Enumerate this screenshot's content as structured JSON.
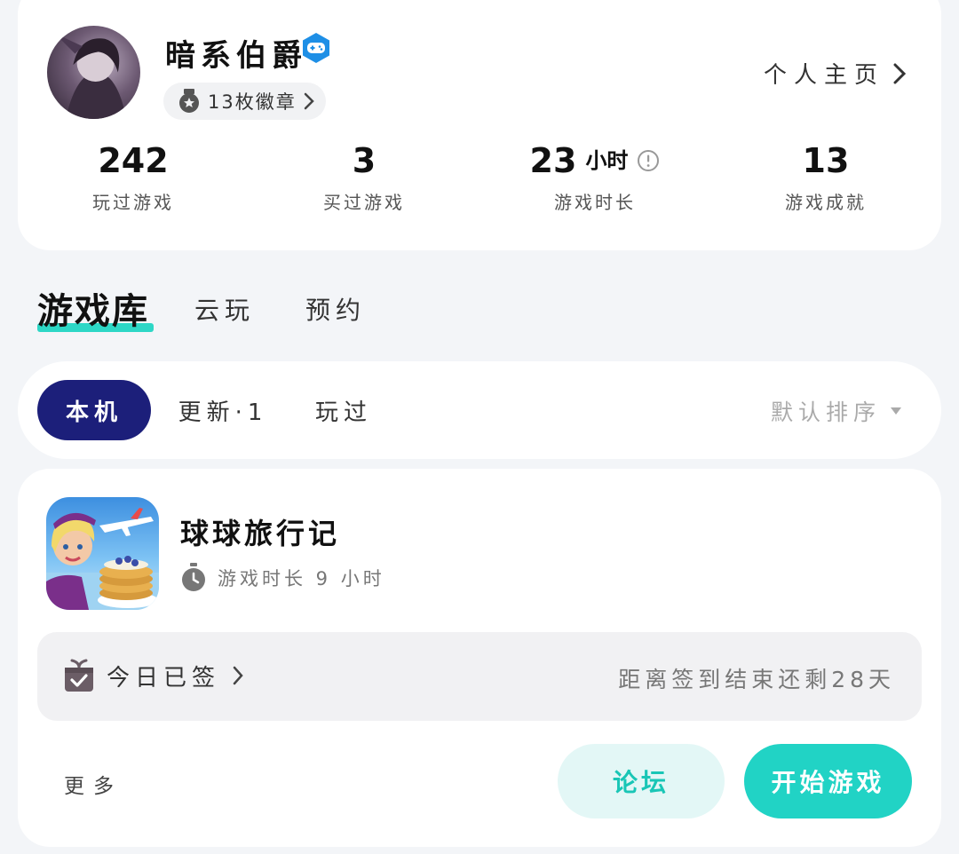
{
  "profile": {
    "username": "暗系伯爵",
    "badge_icon": "gamepad-verify-icon",
    "medal_chip": "13枚徽章",
    "homepage_link": "个人主页",
    "stats": [
      {
        "value": "242",
        "unit": "",
        "label": "玩过游戏"
      },
      {
        "value": "3",
        "unit": "",
        "label": "买过游戏"
      },
      {
        "value": "23",
        "unit": "小时",
        "label": "游戏时长"
      },
      {
        "value": "13",
        "unit": "",
        "label": "游戏成就"
      }
    ]
  },
  "main_tabs": [
    {
      "label": "游戏库",
      "active": true
    },
    {
      "label": "云玩",
      "active": false
    },
    {
      "label": "预约",
      "active": false
    }
  ],
  "filter": {
    "pills": [
      "本机",
      "更新·1",
      "玩过"
    ],
    "sort_label": "默认排序"
  },
  "game_card": {
    "title": "球球旅行记",
    "playtime": "游戏时长 9 小时",
    "checkin_status": "今日已签",
    "checkin_remaining": "距离签到结束还剩28天",
    "more_label": "更多",
    "forum_label": "论坛",
    "play_label": "开始游戏"
  },
  "colors": {
    "accent": "#21d3c5",
    "active_pill": "#1c1f7a",
    "verify_blue": "#1e8fe6",
    "background": "#f3f5f8"
  }
}
